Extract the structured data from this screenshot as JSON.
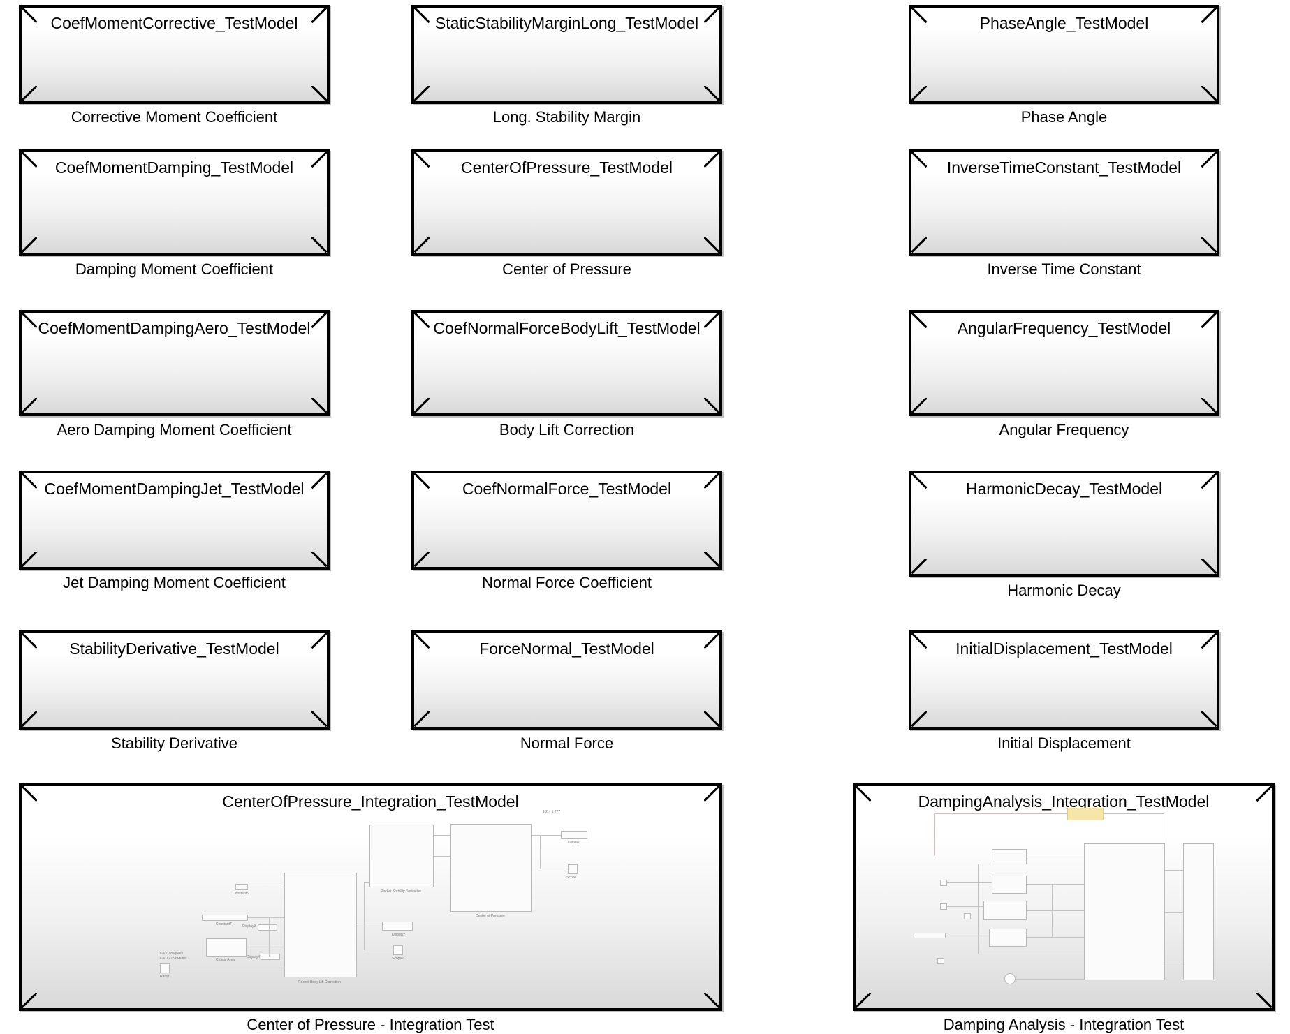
{
  "blocks": [
    {
      "title": "CoefMomentCorrective_TestModel",
      "caption": "Corrective Moment Coefficient"
    },
    {
      "title": "StaticStabilityMarginLong_TestModel",
      "caption": "Long. Stability Margin"
    },
    {
      "title": "PhaseAngle_TestModel",
      "caption": "Phase Angle"
    },
    {
      "title": "CoefMomentDamping_TestModel",
      "caption": "Damping Moment Coefficient"
    },
    {
      "title": "CenterOfPressure_TestModel",
      "caption": "Center of Pressure"
    },
    {
      "title": "InverseTimeConstant_TestModel",
      "caption": "Inverse Time Constant"
    },
    {
      "title": "CoefMomentDampingAero_TestModel",
      "caption": "Aero Damping Moment Coefficient"
    },
    {
      "title": "CoefNormalForceBodyLift_TestModel",
      "caption": "Body Lift Correction"
    },
    {
      "title": "AngularFrequency_TestModel",
      "caption": "Angular Frequency"
    },
    {
      "title": "CoefMomentDampingJet_TestModel",
      "caption": "Jet Damping Moment Coefficient"
    },
    {
      "title": "CoefNormalForce_TestModel",
      "caption": "Normal Force Coefficient"
    },
    {
      "title": "HarmonicDecay_TestModel",
      "caption": "Harmonic Decay"
    },
    {
      "title": "StabilityDerivative_TestModel",
      "caption": "Stability Derivative"
    },
    {
      "title": "ForceNormal_TestModel",
      "caption": "Normal Force"
    },
    {
      "title": "InitialDisplacement_TestModel",
      "caption": "Initial Displacement"
    },
    {
      "title": "CenterOfPressure_Integration_TestModel",
      "caption": "Center of Pressure - Integration Test"
    },
    {
      "title": "DampingAnalysis_Integration_TestModel",
      "caption": "Damping Analysis - Integration Test"
    }
  ],
  "cop_thumbnail": {
    "labels": {
      "top_note": "1.2 > 1.777",
      "constant": "Constant6",
      "constant7": "Constant7",
      "display3": "Display3",
      "display4": "Display4",
      "critical_area": "Critical Area",
      "ramp_note1": "0 -> 10 degrees",
      "ramp_note2": "0 -> 0.175 radians",
      "ramp": "Ramp",
      "body_lift": "Rocket Body Lift Correction",
      "stability_deriv": "Rocket Stability Derivative",
      "center_pressure": "Center of Pressure",
      "display": "Display",
      "scope": "Scope",
      "display2": "Display2",
      "scope2": "Scope2"
    }
  }
}
